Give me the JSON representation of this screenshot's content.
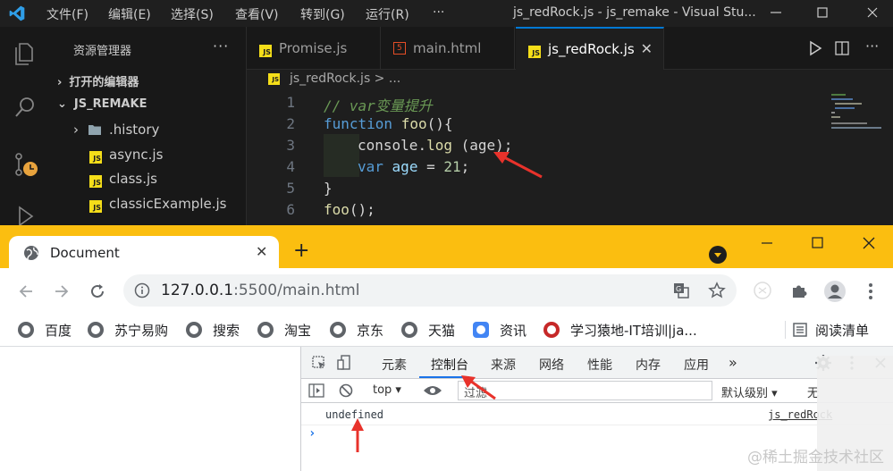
{
  "vscode": {
    "menus": [
      "文件(F)",
      "编辑(E)",
      "选择(S)",
      "查看(V)",
      "转到(G)",
      "运行(R)",
      "···"
    ],
    "title": "js_redRock.js - js_remake - Visual Stu...",
    "explorer_title": "资源管理器",
    "explorer_more": "···",
    "open_editors": "打开的编辑器",
    "project": "JS_REMAKE",
    "files": [
      ".history",
      "async.js",
      "class.js",
      "classicExample.js"
    ],
    "tabs": [
      "Promise.js",
      "main.html",
      "js_redRock.js"
    ],
    "breadcrumb": "js_redRock.js > ...",
    "line_numbers": [
      "1",
      "2",
      "3",
      "4",
      "5",
      "6"
    ],
    "code": {
      "l1": "// var变量提升",
      "l2_kw": "function",
      "l2_fn": "foo",
      "l2_rest": "(){",
      "l3_obj": "console",
      "l3_dot": ".",
      "l3_fn": "log",
      "l3_rest_open": " (",
      "l3_arg": "age",
      "l3_rest_close": ");",
      "l4_kw": "var",
      "l4_var": "age",
      "l4_eq": " = ",
      "l4_num": "21",
      "l4_semi": ";",
      "l5": "}",
      "l6_fn": "foo",
      "l6_rest": "();"
    },
    "accent": "#0078d4"
  },
  "chrome": {
    "tab_title": "Document",
    "tab_close": "✕",
    "new_tab": "+",
    "url_host": "127.0.0.1",
    "url_rest": ":5500/main.html",
    "bookmarks": [
      "百度",
      "苏宁易购",
      "搜索",
      "淘宝",
      "京东",
      "天猫",
      "资讯",
      "学习猿地-IT培训|ja..."
    ],
    "reading_list": "阅读清单",
    "accent": "#fbbe10"
  },
  "devtools": {
    "tabs": [
      "元素",
      "控制台",
      "来源",
      "网络",
      "性能",
      "内存",
      "应用",
      "»"
    ],
    "context": "top ▾",
    "filter_placeholder": "过滤",
    "levels": "默认级别 ▾",
    "issues": "无",
    "console_output": "undefined",
    "console_source": "js_redRock",
    "prompt": "›"
  },
  "watermark": "@稀土掘金技术社区"
}
